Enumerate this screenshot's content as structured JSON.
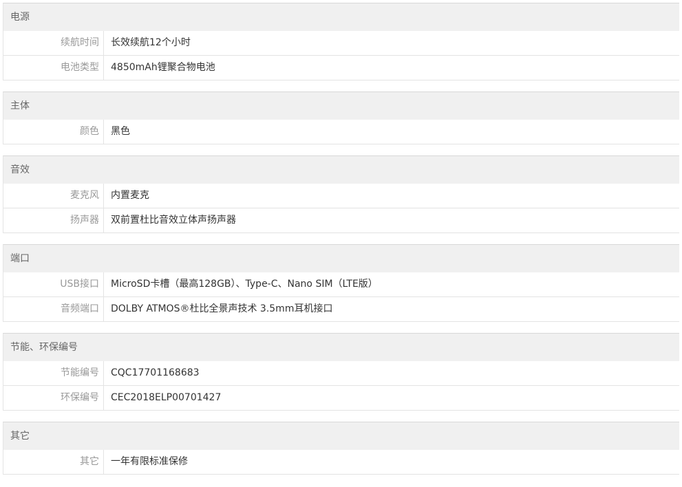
{
  "groups": [
    {
      "title": "电源",
      "rows": [
        {
          "label": "续航时间",
          "value": "长效续航12个小时"
        },
        {
          "label": "电池类型",
          "value": "4850mAh锂聚合物电池"
        }
      ]
    },
    {
      "title": "主体",
      "rows": [
        {
          "label": "颜色",
          "value": "黑色"
        }
      ]
    },
    {
      "title": "音效",
      "rows": [
        {
          "label": "麦克风",
          "value": "内置麦克"
        },
        {
          "label": "扬声器",
          "value": "双前置杜比音效立体声扬声器"
        }
      ]
    },
    {
      "title": "端口",
      "rows": [
        {
          "label": "USB接口",
          "value": "MicroSD卡槽（最高128GB）、Type-C、Nano SIM（LTE版）"
        },
        {
          "label": "音频端口",
          "value": "DOLBY ATMOS®杜比全景声技术 3.5mm耳机接口"
        }
      ]
    },
    {
      "title": "节能、环保编号",
      "rows": [
        {
          "label": "节能编号",
          "value": "CQC17701168683"
        },
        {
          "label": "环保编号",
          "value": "CEC2018ELP00701427"
        }
      ]
    },
    {
      "title": "其它",
      "rows": [
        {
          "label": "其它",
          "value": "一年有限标准保修"
        }
      ]
    }
  ]
}
